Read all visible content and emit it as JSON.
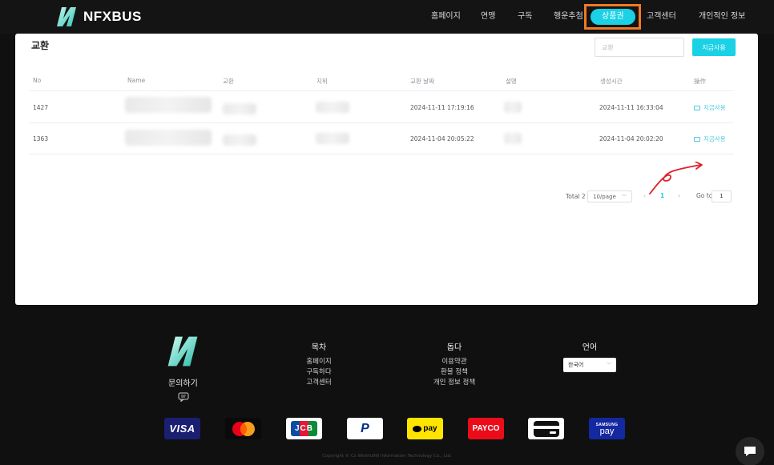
{
  "header": {
    "brand": "NFXBUS",
    "nav": [
      {
        "label": "홈페이지"
      },
      {
        "label": "연맹"
      },
      {
        "label": "구독"
      },
      {
        "label": "행운추첨"
      },
      {
        "label": "상품권",
        "active": true
      },
      {
        "label": "고객센터"
      },
      {
        "label": "개인적인 정보"
      }
    ],
    "highlight_color": "#f07a22"
  },
  "main": {
    "title": "교환",
    "search_placeholder": "교환",
    "search_button": "지금사용",
    "table": {
      "columns": [
        "No",
        "Name",
        "교환",
        "지위",
        "교환 날짜",
        "설명",
        "생성시간",
        "操作"
      ],
      "rows": [
        {
          "no": "1427",
          "date": "2024-11-11 17:19:16",
          "created": "2024-11-11 16:33:04",
          "action": "지금사용"
        },
        {
          "no": "1363",
          "date": "2024-11-04 20:05:22",
          "created": "2024-11-04 20:02:20",
          "action": "지금사용"
        }
      ]
    },
    "pagination": {
      "total": "Total 2",
      "page_size": "10/page",
      "current": "1",
      "goto_label": "Go to",
      "goto_value": "1"
    }
  },
  "footer": {
    "inquiry": "문의하기",
    "columns": [
      {
        "heading": "목차",
        "links": [
          "홈페이지",
          "구독하다",
          "고객센터"
        ]
      },
      {
        "heading": "돕다",
        "links": [
          "이용약관",
          "환불 정책",
          "개인 정보 정책"
        ]
      },
      {
        "heading": "언어",
        "links": []
      }
    ],
    "language": "한국어",
    "payments": [
      {
        "name": "visa",
        "label": "VISA"
      },
      {
        "name": "mastercard",
        "label": ""
      },
      {
        "name": "jcb",
        "label": "JCB"
      },
      {
        "name": "paypal",
        "label": "P"
      },
      {
        "name": "kakaopay",
        "label": "pay"
      },
      {
        "name": "payco",
        "label": "PAYCO"
      },
      {
        "name": "card",
        "label": ""
      },
      {
        "name": "samsung-pay",
        "label_top": "SAMSUNG",
        "label_bottom": "pay"
      }
    ],
    "copyright": "Copyright © Cs Wishfulfill Information Technology Co., Ltd."
  },
  "colors": {
    "accent": "#1ad1e5",
    "background": "#101010",
    "annotation": "#e0202a"
  }
}
